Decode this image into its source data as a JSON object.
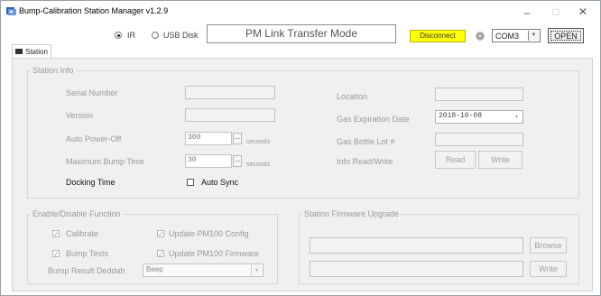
{
  "window": {
    "title": "Bump-Calibration Station Manager v1.2.9",
    "minimize": "–",
    "maximize": "□",
    "close": "✕"
  },
  "toolbar": {
    "radio_ir": "IR",
    "radio_usb": "USB Disk",
    "mode_text": "PM Link Transfer Mode",
    "disconnect_label": "Disconnect",
    "com_port": "COM3",
    "open_label": "OPEN"
  },
  "tab": {
    "label": "Station"
  },
  "station_info": {
    "title": "Station Info",
    "serial_number_label": "Serial Number",
    "version_label": "Version",
    "auto_power_off_label": "Auto Power-Off",
    "auto_power_off_value": "300",
    "auto_power_off_unit": "seconds",
    "max_bump_time_label": "Maximum Bump Time",
    "max_bump_time_value": "30",
    "max_bump_time_unit": "seconds",
    "docking_time_label": "Docking Time",
    "auto_sync_label": "Auto Sync",
    "location_label": "Location",
    "gas_expiration_label": "Gas Expiration Date",
    "gas_expiration_value": "2018-10-08",
    "gas_bottle_lot_label": "Gas Bottle Lot #",
    "info_rw_label": "Info Read/Write",
    "read_label": "Read",
    "write_label": "Write"
  },
  "enable_disable": {
    "title": "Enable/Disable Function",
    "calibrate_label": "Calibrate",
    "bump_tests_label": "Bump Tests",
    "update_config_label": "Update PM100 Config",
    "update_firmware_label": "Update PM100 Firmware",
    "bump_result_label": "Bump Result Deddah",
    "bump_result_value": "Beep"
  },
  "firmware_upgrade": {
    "title": "Station Firmware Upgrade",
    "browse_label": "Browse",
    "write_label": "Write"
  },
  "colors": {
    "disconnect_bg": "#ffff00",
    "titlebar_icon": "#2b5fb8"
  }
}
